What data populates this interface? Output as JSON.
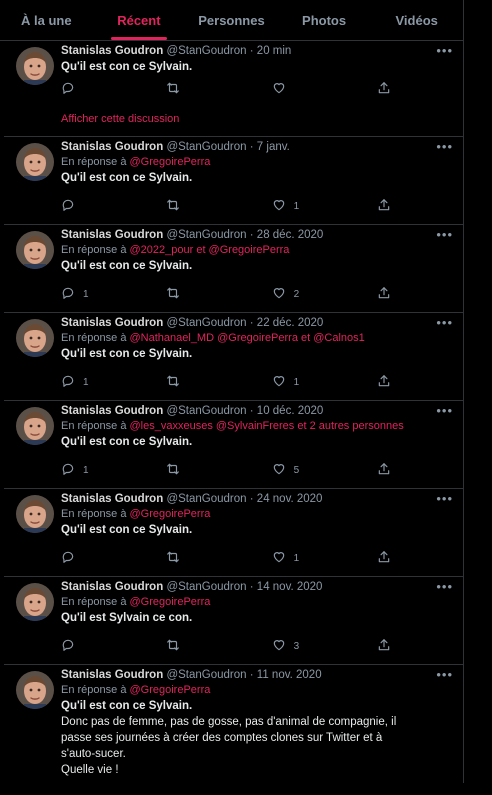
{
  "tabs": [
    {
      "label": "À la une"
    },
    {
      "label": "Récent"
    },
    {
      "label": "Personnes"
    },
    {
      "label": "Photos"
    },
    {
      "label": "Vidéos"
    }
  ],
  "active_tab_index": 1,
  "colors": {
    "accent": "#e0245e",
    "muted": "#8b98a5",
    "divider": "#2f3336"
  },
  "icons": {
    "reply": "reply-icon",
    "retweet": "retweet-icon",
    "like": "heart-icon",
    "share": "share-icon",
    "more": "more-icon"
  },
  "tweets": [
    {
      "name": "Stanislas Goudron",
      "handle": "@StanGoudron",
      "dot": "·",
      "time": "20 min",
      "text": "Qu'il est con ce Sylvain.",
      "replies": "",
      "retweets": "",
      "likes": "",
      "show_thread": "Afficher cette discussion"
    },
    {
      "name": "Stanislas Goudron",
      "handle": "@StanGoudron",
      "dot": "·",
      "time": "7 janv.",
      "reply_prefix": "En réponse à",
      "mentions": "@GregoirePerra",
      "text": "Qu'il est con ce Sylvain.",
      "replies": "",
      "retweets": "",
      "likes": "1"
    },
    {
      "name": "Stanislas Goudron",
      "handle": "@StanGoudron",
      "dot": "·",
      "time": "28 déc. 2020",
      "reply_prefix": "En réponse à",
      "mentions": "@2022_pour  et  @GregoirePerra",
      "text": "Qu'il est con ce Sylvain.",
      "replies": "1",
      "retweets": "",
      "likes": "2"
    },
    {
      "name": "Stanislas Goudron",
      "handle": "@StanGoudron",
      "dot": "·",
      "time": "22 déc. 2020",
      "reply_prefix": "En réponse à",
      "mentions": "@Nathanael_MD @GregoirePerra  et  @Calnos1",
      "text": "Qu'il est con ce Sylvain.",
      "replies": "1",
      "retweets": "",
      "likes": "1"
    },
    {
      "name": "Stanislas Goudron",
      "handle": "@StanGoudron",
      "dot": "·",
      "time": "10 déc. 2020",
      "reply_prefix": "En réponse à",
      "mentions": "@les_vaxxeuses @SylvainFreres  et 2 autres personnes",
      "text": "Qu'il est con ce Sylvain.",
      "replies": "1",
      "retweets": "",
      "likes": "5"
    },
    {
      "name": "Stanislas Goudron",
      "handle": "@StanGoudron",
      "dot": "·",
      "time": "24 nov. 2020",
      "reply_prefix": "En réponse à",
      "mentions": "@GregoirePerra",
      "text": "Qu'il est con ce Sylvain.",
      "replies": "",
      "retweets": "",
      "likes": "1"
    },
    {
      "name": "Stanislas Goudron",
      "handle": "@StanGoudron",
      "dot": "·",
      "time": "14 nov. 2020",
      "reply_prefix": "En réponse à",
      "mentions": "@GregoirePerra",
      "text": "Qu'il est Sylvain ce con.",
      "replies": "",
      "retweets": "",
      "likes": "3"
    },
    {
      "name": "Stanislas Goudron",
      "handle": "@StanGoudron",
      "dot": "·",
      "time": "11 nov. 2020",
      "reply_prefix": "En réponse à",
      "mentions": "@GregoirePerra",
      "text": "Qu'il est con ce Sylvain.",
      "body": [
        "Donc pas de femme, pas de gosse, pas d'animal de compagnie, il",
        "passe ses journées à créer des comptes clones sur Twitter et à",
        "s'auto-sucer.",
        "Quelle vie !"
      ]
    }
  ]
}
